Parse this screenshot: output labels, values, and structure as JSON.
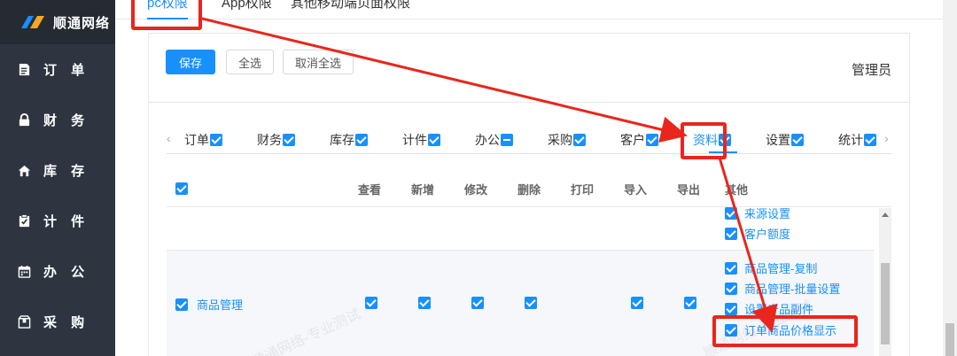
{
  "sidebar": {
    "logo_text": "顺通网络",
    "items": [
      {
        "label": "订 单",
        "icon": "document-icon"
      },
      {
        "label": "财 务",
        "icon": "lock-icon"
      },
      {
        "label": "库 存",
        "icon": "home-icon"
      },
      {
        "label": "计 件",
        "icon": "clipboard-icon"
      },
      {
        "label": "办 公",
        "icon": "calendar-icon"
      },
      {
        "label": "采 购",
        "icon": "package-icon"
      }
    ]
  },
  "top_tabs": [
    "pc权限",
    "App权限",
    "其他移动端页面权限"
  ],
  "toolbar": {
    "save": "保存",
    "select_all": "全选",
    "deselect_all": "取消全选",
    "role": "管理员"
  },
  "category_tabs": [
    {
      "label": "订单",
      "state": "checked"
    },
    {
      "label": "财务",
      "state": "checked"
    },
    {
      "label": "库存",
      "state": "checked"
    },
    {
      "label": "计件",
      "state": "checked"
    },
    {
      "label": "办公",
      "state": "partial"
    },
    {
      "label": "采购",
      "state": "checked"
    },
    {
      "label": "客户",
      "state": "checked"
    },
    {
      "label": "资料",
      "state": "checked",
      "active": true
    },
    {
      "label": "设置",
      "state": "checked"
    },
    {
      "label": "统计",
      "state": "checked"
    }
  ],
  "table": {
    "columns": [
      "查看",
      "新增",
      "修改",
      "删除",
      "打印",
      "导入",
      "导出",
      "其他"
    ],
    "row1_other": [
      "来源设置",
      "客户额度"
    ],
    "row2": {
      "name": "商品管理",
      "other": [
        "商品管理-复制",
        "商品管理-批量设置",
        "设置产品副件",
        "订单商品价格显示"
      ]
    }
  },
  "watermark": "顺通网络-专业测试",
  "colors": {
    "accent": "#1890ff",
    "sidebar": "#2f3540",
    "highlight": "#e8261d"
  }
}
